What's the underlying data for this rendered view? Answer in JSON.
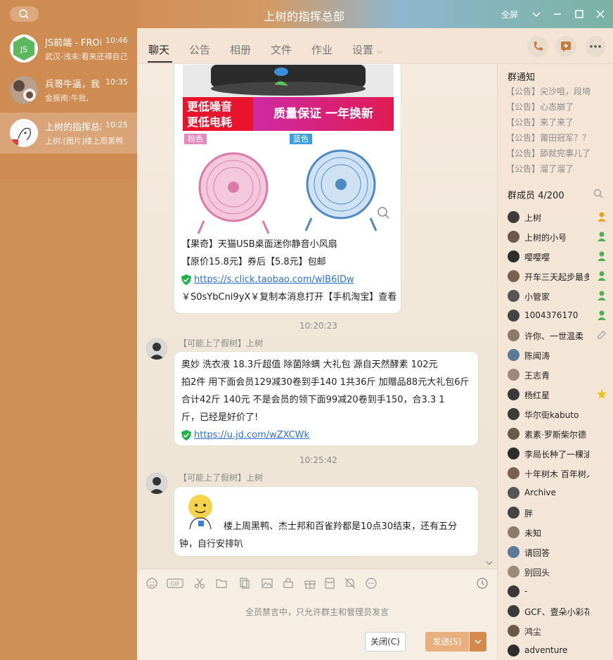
{
  "window": {
    "title": "上树的指挥总部",
    "right_label": "全屏"
  },
  "conversations": [
    {
      "name": "JS前端 - FRONTEND",
      "time": "10:46",
      "preview": "武汉-浅末:看来还得自己"
    },
    {
      "name": "兵哥牛逼，我",
      "time": "10:35",
      "preview": "金振南:牛批,"
    },
    {
      "name": "上树的指挥总部",
      "time": "10:25",
      "preview": "上树:[图片]楼上周黑鸭"
    }
  ],
  "tabs": [
    "聊天",
    "公告",
    "相册",
    "文件",
    "作业",
    "设置"
  ],
  "product_card": {
    "banner_left_1": "更低噪音",
    "banner_left_2": "更低电耗",
    "banner_right": "质量保证 一年换新",
    "tag_pink": "粉色",
    "tag_blue": "蓝色",
    "line1": "【果奇】天猫USB桌面迷你静音小风扇",
    "line2": "【原价15.8元】券后【5.8元】包邮",
    "link": "https://s.click.taobao.com/wlB6lDw",
    "line4": "￥S0sYbCni9yX￥复制本消息打开【手机淘宝】查看"
  },
  "messages": [
    {
      "time": "10:20:23",
      "sender": "【可能上了假树】上树",
      "lines": [
        "奥妙 洗衣液 18.3斤超值 除菌除螨 大礼包 源自天然酵素  102元",
        "拍2件 用下面会员129减30卷到手140 1共36斤 加赠品88元大礼包6斤",
        "合计42斤  140元     不是会员的领下面99减20卷到手150，合3.3   1",
        "斤，已经是好价了!"
      ],
      "link": "https://u.jd.com/wZXCWk"
    },
    {
      "time": "10:25:42",
      "sender": "【可能上了假树】上树",
      "line1": "楼上周黑鸭、杰士邦和百雀羚都是10点30结束，还有五分",
      "line2": "钟，自行安排叭"
    }
  ],
  "input": {
    "mute_notice": "全员禁言中，只允许群主和管理员发言",
    "close_label": "关闭(C)",
    "send_label": "发送(S)"
  },
  "right_panel": {
    "notice_title": "群通知",
    "notices": [
      "【公告】尖沙咀，段埼",
      "【公告】心态崩了",
      "【公告】来了来了",
      "【公告】莆田冠军？？",
      "【公告】舔就完事儿了",
      "【公告】溜了溜了"
    ],
    "members_title": "群成员 4/200",
    "members": [
      {
        "name": "上树",
        "badge": "owner"
      },
      {
        "name": "上树的小号",
        "badge": "admin"
      },
      {
        "name": "嘤嘤嘤",
        "badge": "admin"
      },
      {
        "name": "开车三天起步最多",
        "badge": "admin"
      },
      {
        "name": "小管家",
        "badge": "admin"
      },
      {
        "name": "1004376170",
        "badge": "admin"
      },
      {
        "name": "许你、一世温柔",
        "badge": "edit"
      },
      {
        "name": "陈闻涛",
        "badge": ""
      },
      {
        "name": "王志青",
        "badge": ""
      },
      {
        "name": "杨红星",
        "badge": "star"
      },
      {
        "name": "华尔街kabuto",
        "badge": ""
      },
      {
        "name": "素素·罗斯柴尔德",
        "badge": ""
      },
      {
        "name": "李局长种了一棵油门",
        "badge": ""
      },
      {
        "name": "十年树木  百年树人",
        "badge": ""
      },
      {
        "name": "Archive",
        "badge": ""
      },
      {
        "name": "胖",
        "badge": ""
      },
      {
        "name": "未知",
        "badge": ""
      },
      {
        "name": "请回答",
        "badge": ""
      },
      {
        "name": "别回头",
        "badge": ""
      },
      {
        "name": "-",
        "badge": ""
      },
      {
        "name": "GCF、壹朵小彩花",
        "badge": ""
      },
      {
        "name": "鸿尘",
        "badge": ""
      },
      {
        "name": "adventure",
        "badge": ""
      }
    ]
  },
  "colors": {
    "sidebar": "#cf8c52",
    "link": "#2a6fd6",
    "send_button": "#e9b07e",
    "owner_badge": "#f0a020",
    "admin_badge": "#4caf50"
  }
}
